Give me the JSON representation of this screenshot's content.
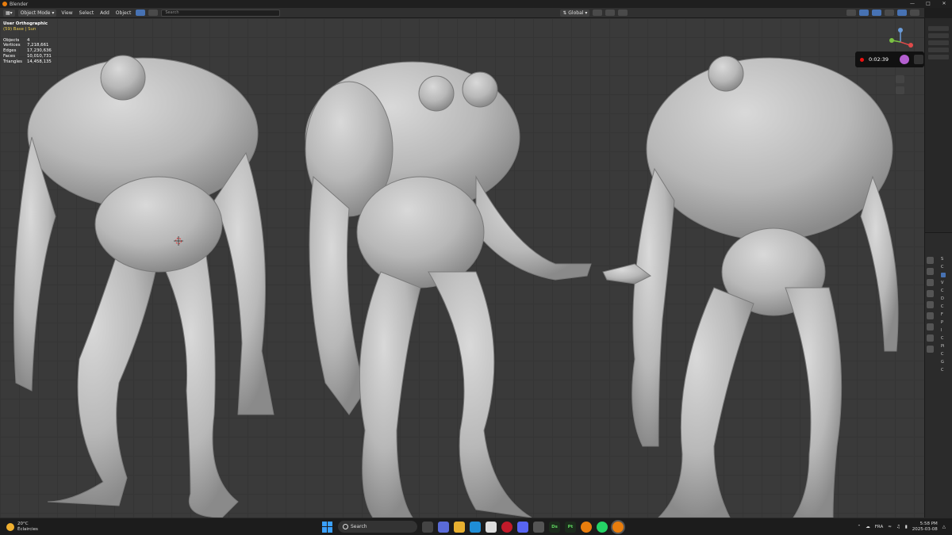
{
  "window": {
    "title": "Blender"
  },
  "header": {
    "editor_icon": "view3d-icon",
    "mode": "Object Mode",
    "menus": [
      "View",
      "Select",
      "Add",
      "Object"
    ],
    "search_placeholder": "Search",
    "orientation": "Global"
  },
  "viewport": {
    "view_name": "User Orthographic",
    "collection": "(59) Base | Sun",
    "stats": [
      {
        "label": "Objects",
        "value": "4"
      },
      {
        "label": "Vertices",
        "value": "7,218,661"
      },
      {
        "label": "Edges",
        "value": "17,230,636"
      },
      {
        "label": "Faces",
        "value": "10,010,731"
      },
      {
        "label": "Triangles",
        "value": "14,458,135"
      }
    ]
  },
  "recorder": {
    "time": "0:02:39",
    "status_color": "#e11111"
  },
  "props_panel": {
    "letters": [
      "S",
      "C",
      "V",
      "C",
      "D",
      "C",
      "F",
      "P",
      "I",
      "C",
      "Pi",
      "C",
      "G",
      "C"
    ]
  },
  "taskbar": {
    "weather_temp": "20°C",
    "weather_desc": "Éclaircies",
    "search_label": "Search",
    "apps": [
      {
        "name": "taskview-icon",
        "label": ""
      },
      {
        "name": "copilot-icon",
        "label": ""
      },
      {
        "name": "explorer-icon",
        "label": ""
      },
      {
        "name": "edge-icon",
        "label": ""
      },
      {
        "name": "calendar-icon",
        "label": ""
      },
      {
        "name": "opera-icon",
        "label": ""
      },
      {
        "name": "discord-icon",
        "label": ""
      },
      {
        "name": "unity-icon",
        "label": ""
      },
      {
        "name": "designer-icon",
        "label": "Ds"
      },
      {
        "name": "painter-icon",
        "label": "Pt"
      },
      {
        "name": "blender-icon",
        "label": ""
      },
      {
        "name": "whatsapp-icon",
        "label": ""
      },
      {
        "name": "blender-active-icon",
        "label": ""
      }
    ],
    "language": "FRA",
    "time": "5:58 PM",
    "date": "2025-03-08"
  },
  "colors": {
    "accent": "#4772b3",
    "brand": "#e87d0d",
    "collection": "#e6c84a"
  }
}
